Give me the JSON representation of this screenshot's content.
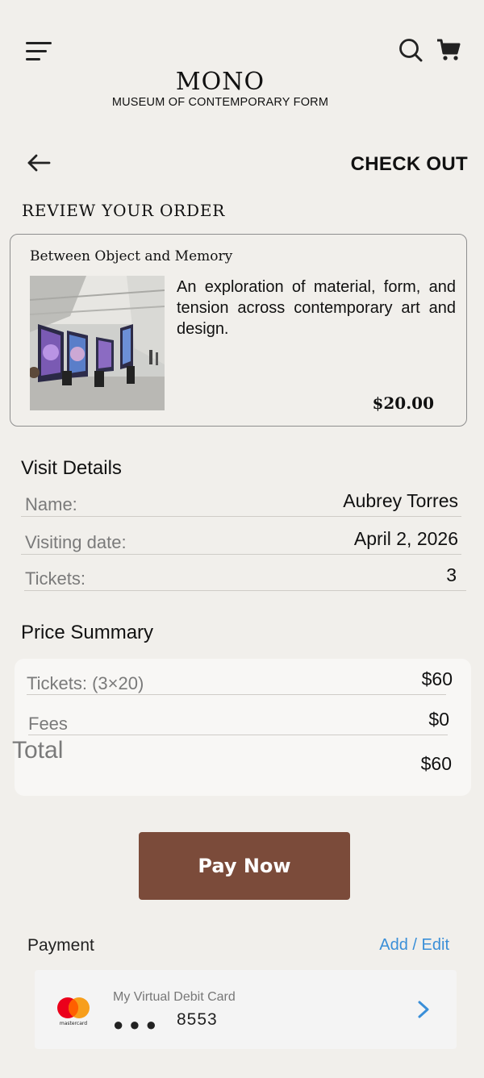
{
  "header": {
    "brand_name": "MONO",
    "brand_subtitle": "MUSEUM OF CONTEMPORARY FORM",
    "icons": [
      "menu-icon",
      "search-icon",
      "cart-icon"
    ]
  },
  "nav": {
    "title": "CHECK OUT",
    "back_icon": "arrow-left-icon"
  },
  "review": {
    "heading": "REVIEW YOUR ORDER",
    "item": {
      "title": "Between Object and Memory",
      "description": "An exploration of material, form, and tension across contemporary art and design.",
      "price": "$20.00"
    }
  },
  "visit": {
    "heading": "Visit Details",
    "rows": [
      {
        "label": "Name:",
        "value": "Aubrey Torres"
      },
      {
        "label": "Visiting date:",
        "value": "April 2, 2026"
      },
      {
        "label": "Tickets:",
        "value": "3"
      }
    ]
  },
  "price_summary": {
    "heading": "Price Summary",
    "tickets_label": "Tickets: (3×20)",
    "tickets_value": "$60",
    "fees_label": "Fees",
    "fees_value": "$0",
    "total_label": "Total",
    "total_value": "$60"
  },
  "actions": {
    "pay_label": "Pay Now"
  },
  "payment": {
    "label": "Payment",
    "add_edit": "Add / Edit",
    "card_name": "My Virtual Debit Card",
    "card_masked": "●●●",
    "card_last4": "8553",
    "brand_text": "mastercard"
  },
  "colors": {
    "background": "#f1efeb",
    "button": "#7b4b3a",
    "link": "#3a8fd8"
  }
}
